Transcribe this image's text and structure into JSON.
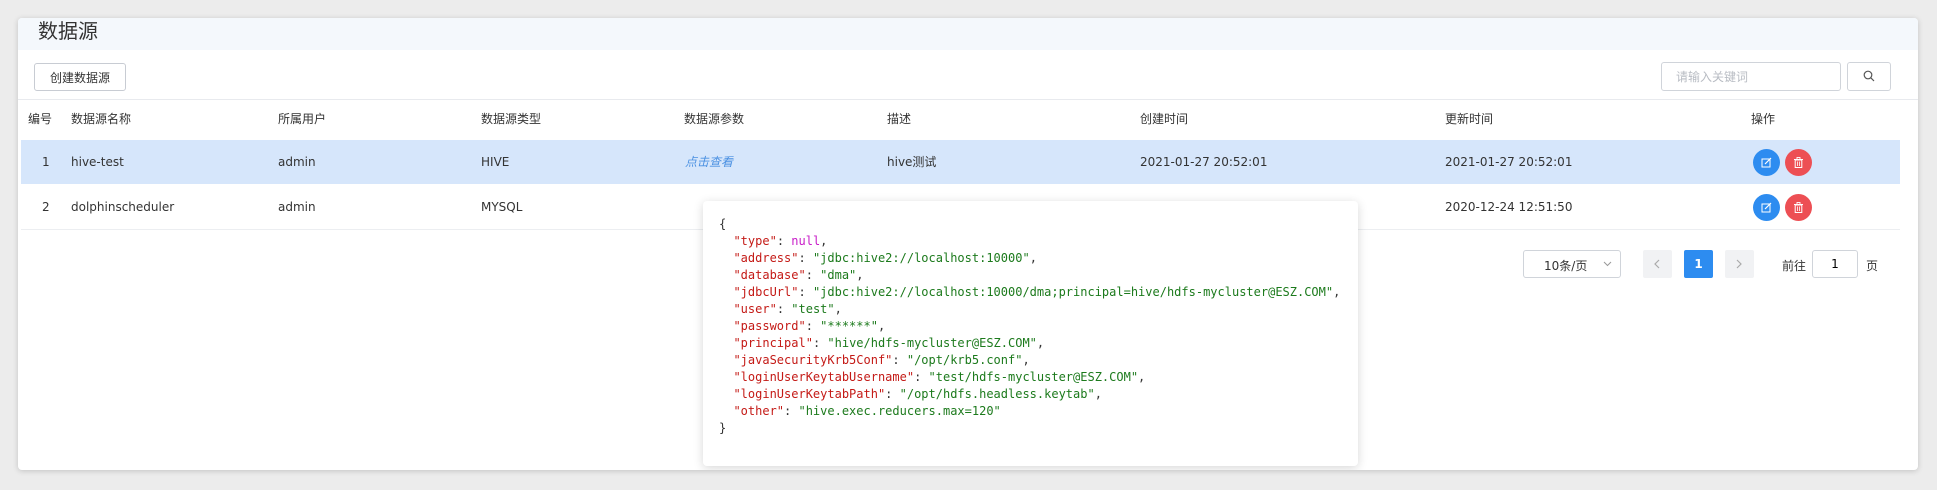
{
  "page": {
    "title": "数据源"
  },
  "toolbar": {
    "create_label": "创建数据源"
  },
  "search": {
    "placeholder": "请输入关键词"
  },
  "table": {
    "headers": [
      "编号",
      "数据源名称",
      "所属用户",
      "数据源类型",
      "数据源参数",
      "描述",
      "创建时间",
      "更新时间",
      "操作"
    ],
    "rows": [
      {
        "id": "1",
        "name": "hive-test",
        "user": "admin",
        "type": "HIVE",
        "params_link": "点击查看",
        "desc": "hive测试",
        "created": "2021-01-27 20:52:01",
        "updated": "2021-01-27 20:52:01"
      },
      {
        "id": "2",
        "name": "dolphinscheduler",
        "user": "admin",
        "type": "MYSQL",
        "params_link": "",
        "desc": "",
        "created": "",
        "updated": "2020-12-24 12:51:50"
      }
    ]
  },
  "popover": {
    "open_brace": "{",
    "close_brace": "}",
    "lines": [
      {
        "key": "\"type\"",
        "value": "null",
        "value_kind": "null",
        "comma": ","
      },
      {
        "key": "\"address\"",
        "value": "\"jdbc:hive2://localhost:10000\"",
        "value_kind": "string",
        "comma": ","
      },
      {
        "key": "\"database\"",
        "value": "\"dma\"",
        "value_kind": "string",
        "comma": ","
      },
      {
        "key": "\"jdbcUrl\"",
        "value": "\"jdbc:hive2://localhost:10000/dma;principal=hive/hdfs-mycluster@ESZ.COM\"",
        "value_kind": "string",
        "comma": ","
      },
      {
        "key": "\"user\"",
        "value": "\"test\"",
        "value_kind": "string",
        "comma": ","
      },
      {
        "key": "\"password\"",
        "value": "\"******\"",
        "value_kind": "string",
        "comma": ","
      },
      {
        "key": "\"principal\"",
        "value": "\"hive/hdfs-mycluster@ESZ.COM\"",
        "value_kind": "string",
        "comma": ","
      },
      {
        "key": "\"javaSecurityKrb5Conf\"",
        "value": "\"/opt/krb5.conf\"",
        "value_kind": "string",
        "comma": ","
      },
      {
        "key": "\"loginUserKeytabUsername\"",
        "value": "\"test/hdfs-mycluster@ESZ.COM\"",
        "value_kind": "string",
        "comma": ","
      },
      {
        "key": "\"loginUserKeytabPath\"",
        "value": "\"/opt/hdfs.headless.keytab\"",
        "value_kind": "string",
        "comma": ","
      },
      {
        "key": "\"other\"",
        "value": "\"hive.exec.reducers.max=120\"",
        "value_kind": "string",
        "comma": ""
      }
    ]
  },
  "pagination": {
    "page_size": "10条/页",
    "current_page": "1",
    "goto_label": "前往",
    "goto_value": "1",
    "goto_unit": "页"
  },
  "icons": {
    "search": "search-icon",
    "edit": "edit-icon",
    "delete": "trash-icon",
    "prev": "chevron-left-icon",
    "next": "chevron-right-icon",
    "dropdown": "chevron-down-icon"
  },
  "colors": {
    "primary": "#2d8cf0",
    "danger": "#ed4f54",
    "selected_row": "#d6e6fb",
    "json_key": "#c41a16",
    "json_string": "#1c7a1c",
    "json_null": "#c81dc8"
  }
}
